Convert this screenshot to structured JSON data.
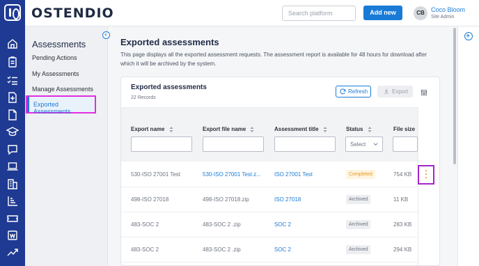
{
  "header": {
    "brand": "OSTENDIO",
    "search_placeholder": "Search platform",
    "add_label": "Add new",
    "user": {
      "initials": "CB",
      "name": "Coco Bloom",
      "role": "Site Admin"
    }
  },
  "rail": {
    "icons": [
      "home-icon",
      "clipboard-icon",
      "checklist-icon",
      "document-plus-icon",
      "file-icon",
      "graduation-cap-icon",
      "chat-icon",
      "laptop-icon",
      "building-icon",
      "chart-icon",
      "ticket-icon",
      "word-doc-icon",
      "trend-icon"
    ]
  },
  "sidebar": {
    "title": "Assessments",
    "items": [
      {
        "label": "Pending Actions"
      },
      {
        "label": "My Assessments"
      },
      {
        "label": "Manage Assessments"
      },
      {
        "label": "Exported Assessments"
      }
    ]
  },
  "page": {
    "title": "Exported assessments",
    "description": "This page displays all the exported assessment requests. The assessment report is available for 48 hours for download after which it will be archived by the system."
  },
  "card": {
    "title": "Exported assessments",
    "count": "22 Records",
    "refresh_label": "Refresh",
    "export_label": "Export"
  },
  "table": {
    "columns": [
      "Export name",
      "Export file name",
      "Assessment title",
      "Status",
      "File size"
    ],
    "status_placeholder": "Select",
    "rows": [
      {
        "export_name": "530-ISO 27001 Test",
        "file_name": "530-ISO 27001 Test.z...",
        "title": "ISO 27001 Test",
        "status": "Completed",
        "size": "754 KB"
      },
      {
        "export_name": "498-ISO 27018",
        "file_name": "498-ISO 27018.zip",
        "title": "ISO 27018",
        "status": "Archived",
        "size": "11 KB"
      },
      {
        "export_name": "483-SOC 2",
        "file_name": "483-SOC 2 .zip",
        "title": "SOC 2",
        "status": "Archived",
        "size": "283 KB"
      },
      {
        "export_name": "483-SOC 2",
        "file_name": "483-SOC 2 .zip",
        "title": "SOC 2",
        "status": "Archived",
        "size": "294 KB"
      }
    ]
  },
  "colors": {
    "rail": "#1f3a93",
    "accent": "#1a7bd6",
    "highlight": "#e12ee0",
    "completed": "#e39a1d"
  }
}
